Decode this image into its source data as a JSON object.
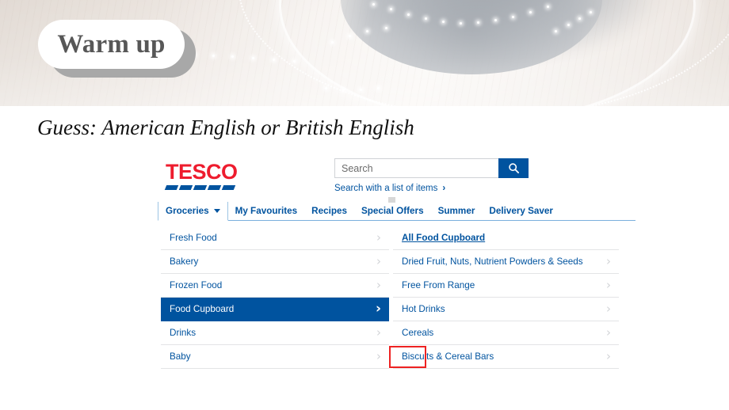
{
  "slide": {
    "badge_label": "Warm up",
    "question": "Guess: American English or British English"
  },
  "tesco": {
    "logo_text": "TESCO",
    "search": {
      "placeholder": "Search",
      "value": "",
      "button_icon": "search-icon",
      "list_link": "Search with a list of items",
      "list_link_arrow": "›"
    },
    "nav": [
      {
        "label": "Groceries",
        "active": true,
        "caret": true
      },
      {
        "label": "My Favourites",
        "active": false,
        "caret": false
      },
      {
        "label": "Recipes",
        "active": false,
        "caret": false
      },
      {
        "label": "Special Offers",
        "active": false,
        "caret": false
      },
      {
        "label": "Summer",
        "active": false,
        "caret": false
      },
      {
        "label": "Delivery Saver",
        "active": false,
        "caret": false
      }
    ],
    "left_column": [
      {
        "label": "Fresh Food",
        "selected": false,
        "chevron": "›"
      },
      {
        "label": "Bakery",
        "selected": false,
        "chevron": "›"
      },
      {
        "label": "Frozen Food",
        "selected": false,
        "chevron": "›"
      },
      {
        "label": "Food Cupboard",
        "selected": true,
        "chevron": "›"
      },
      {
        "label": "Drinks",
        "selected": false,
        "chevron": "›"
      },
      {
        "label": "Baby",
        "selected": false,
        "chevron": "›"
      }
    ],
    "right_column": [
      {
        "label": "All Food Cupboard",
        "heading": true,
        "chevron": ""
      },
      {
        "label": "Dried Fruit, Nuts, Nutrient Powders & Seeds",
        "heading": false,
        "chevron": "›"
      },
      {
        "label": "Free From Range",
        "heading": false,
        "chevron": "›"
      },
      {
        "label": "Hot Drinks",
        "heading": false,
        "chevron": "›"
      },
      {
        "label": "Cereals",
        "heading": false,
        "chevron": "›"
      },
      {
        "label": "Biscuits & Cereal Bars",
        "heading": false,
        "chevron": "›"
      }
    ],
    "annotation": {
      "target": "Biscuits",
      "color": "#ee2222"
    },
    "colors": {
      "tesco_blue": "#00539f",
      "tesco_red": "#ee1c2e",
      "divider": "#e3e4e6"
    }
  }
}
